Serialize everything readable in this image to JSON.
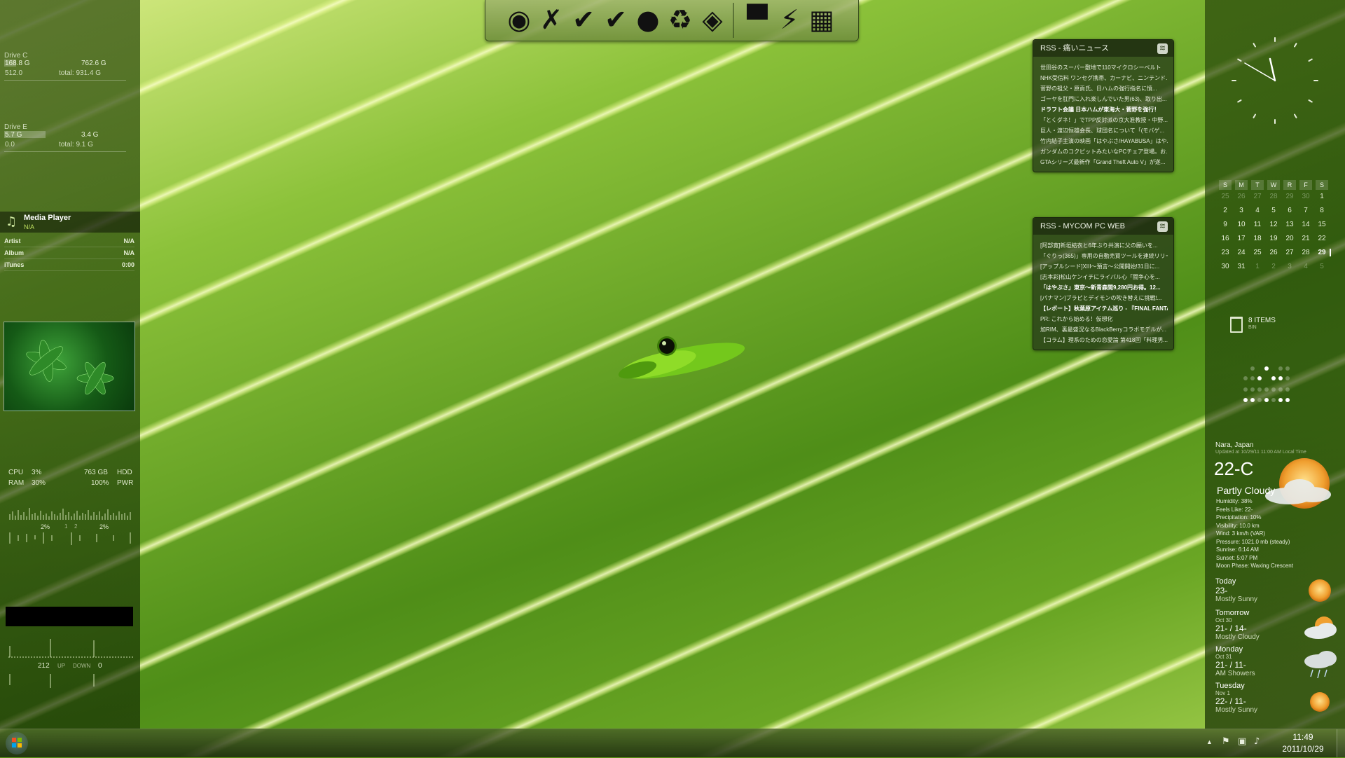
{
  "drives": [
    {
      "label": "Drive C",
      "used": "168.8 G",
      "free": "762.6 G",
      "read": "512.0",
      "total": "total: 931.4 G",
      "used_fraction": 0.18
    },
    {
      "label": "Drive E",
      "used": "5.7 G",
      "free": "3.4 G",
      "read": "0.0",
      "total": "total: 9.1 G",
      "used_fraction": 0.63
    }
  ],
  "media_player": {
    "title": "Media Player",
    "status": "N/A",
    "rows": [
      {
        "label": "Artist",
        "value": "N/A"
      },
      {
        "label": "Album",
        "value": "N/A"
      },
      {
        "label": "iTunes",
        "value": "0:00"
      }
    ]
  },
  "system_meter": {
    "cpu_label": "CPU",
    "cpu_value": "3%",
    "ram_label": "RAM",
    "ram_value": "30%",
    "hdd_value": "763 GB",
    "hdd_label": "HDD",
    "pwr_value": "100%",
    "pwr_label": "PWR",
    "core1": "2%",
    "core_sep1": "1",
    "core_sep2": "2",
    "core2": "2%"
  },
  "network": {
    "up_value": "212",
    "up_label": "UP",
    "down_label": "DOWN",
    "down_value": "0"
  },
  "dock_icons": [
    {
      "name": "firefox-icon",
      "glyph": "◉"
    },
    {
      "name": "cross-icon",
      "glyph": "✗"
    },
    {
      "name": "check-icon",
      "glyph": "✔"
    },
    {
      "name": "check-icon-2",
      "glyph": "✔"
    },
    {
      "name": "apple-icon",
      "glyph": "●"
    },
    {
      "name": "recycle-icon",
      "glyph": "♻"
    },
    {
      "name": "target-icon",
      "glyph": "◈"
    },
    {
      "name": "computer-icon",
      "glyph": "▀"
    },
    {
      "name": "lightning-icon",
      "glyph": "⚡"
    },
    {
      "name": "windows-icon",
      "glyph": "▦"
    }
  ],
  "rss_feeds": [
    {
      "title": "RSS - 痛いニュース",
      "items": [
        {
          "text": "世田谷のスーパー敷地で110マイクロシーベルト",
          "bold": false
        },
        {
          "text": "NHK受信料 ワンセグ携帯、カーナビ、ニンテンド...",
          "bold": false
        },
        {
          "text": "菅野の祖父・原貢氏、日ハムの強行指名に憤...",
          "bold": false
        },
        {
          "text": "ゴーヤを肛門に入れ楽しんでいた男(63)、取り出...",
          "bold": false
        },
        {
          "text": "ドラフト会議 日本ハムが東海大・菅野を強行！",
          "bold": true
        },
        {
          "text": "「とくダネ！」でTPP反対派の京大准教授・中野...",
          "bold": false
        },
        {
          "text": "巨人・渡辺恒雄会長、球団名について「(モバゲ...",
          "bold": false
        },
        {
          "text": "竹内結子主演の映画「はやぶさ/HAYABUSA」はやぶ...",
          "bold": false
        },
        {
          "text": "ガンダムのコクピットみたいなPCチェア登場。お...",
          "bold": false
        },
        {
          "text": "GTAシリーズ最新作「Grand Theft Auto V」が遂...",
          "bold": false
        }
      ]
    },
    {
      "title": "RSS - MYCOM PC WEB",
      "items": [
        {
          "text": "[阿部寛]新垣結衣と6年ぶり共演に父の願いを...",
          "bold": false
        },
        {
          "text": "「ぐりっ(365)」専用の自動売買ツールを連続リリー...",
          "bold": false
        },
        {
          "text": "[アップルシード]XIII～預言～公開開始!31日に...",
          "bold": false
        },
        {
          "text": "[志本彩]松山ケンイチにライバル心「闘争心を...",
          "bold": false
        },
        {
          "text": "「はやぶさ」東京～新青森間9,280円お得。12...",
          "bold": true
        },
        {
          "text": "[パナマン]ブラピとデイモンの吹き替えに挑戦!...",
          "bold": false
        },
        {
          "text": "【レポート】秋葉原アイテム巡り - 『FINAL FANTA...",
          "bold": true
        },
        {
          "text": "PR: これから始める！仮想化",
          "bold": false
        },
        {
          "text": "加RIM、裏最盛況なるBlackBerryコラボモデルが...",
          "bold": false
        },
        {
          "text": "【コラム】理系のための恋愛論 第418回「料理男...",
          "bold": false
        }
      ]
    }
  ],
  "calendar": {
    "headers": [
      "S",
      "M",
      "T",
      "W",
      "R",
      "F",
      "S"
    ],
    "weeks": [
      [
        {
          "d": "25",
          "dim": true
        },
        {
          "d": "26",
          "dim": true
        },
        {
          "d": "27",
          "dim": true
        },
        {
          "d": "28",
          "dim": true
        },
        {
          "d": "29",
          "dim": true
        },
        {
          "d": "30",
          "dim": true
        },
        {
          "d": "1"
        }
      ],
      [
        {
          "d": "2"
        },
        {
          "d": "3"
        },
        {
          "d": "4"
        },
        {
          "d": "5"
        },
        {
          "d": "6"
        },
        {
          "d": "7"
        },
        {
          "d": "8"
        }
      ],
      [
        {
          "d": "9"
        },
        {
          "d": "10"
        },
        {
          "d": "11"
        },
        {
          "d": "12"
        },
        {
          "d": "13"
        },
        {
          "d": "14"
        },
        {
          "d": "15"
        }
      ],
      [
        {
          "d": "16"
        },
        {
          "d": "17"
        },
        {
          "d": "18"
        },
        {
          "d": "19"
        },
        {
          "d": "20"
        },
        {
          "d": "21"
        },
        {
          "d": "22"
        }
      ],
      [
        {
          "d": "23"
        },
        {
          "d": "24"
        },
        {
          "d": "25"
        },
        {
          "d": "26"
        },
        {
          "d": "27"
        },
        {
          "d": "28"
        },
        {
          "d": "29",
          "today": true
        }
      ],
      [
        {
          "d": "30"
        },
        {
          "d": "31"
        },
        {
          "d": "1",
          "dim": true
        },
        {
          "d": "2",
          "dim": true
        },
        {
          "d": "3",
          "dim": true
        },
        {
          "d": "4",
          "dim": true
        },
        {
          "d": "5",
          "dim": true
        }
      ]
    ]
  },
  "recycle_bin": {
    "count": "8 ITEMS",
    "label": "BIN"
  },
  "weather": {
    "location": "Nara, Japan",
    "updated": "Updated at 10/29/11 11:00 AM Local Time",
    "temp": "22-C",
    "condition": "Partly Cloudy",
    "details": [
      "Humidity: 38%",
      "Feels Like: 22-",
      "Precipitation: 10%",
      "Visibility: 10.0 km",
      "Wind: 3 km/h (VAR)",
      "Pressure: 1021.0 mb (steady)",
      "Sunrise: 6:14 AM",
      "Sunset: 5:07 PM",
      "Moon Phase: Waxing Crescent"
    ],
    "forecast": [
      {
        "day": "Today",
        "date": "",
        "temps": "23-",
        "cond": "Mostly Sunny",
        "icon": "sun-icon"
      },
      {
        "day": "Tomorrow",
        "date": "Oct 30",
        "temps": "21- / 14-",
        "cond": "Mostly Cloudy",
        "icon": "cloud-icon"
      },
      {
        "day": "Monday",
        "date": "Oct 31",
        "temps": "21- / 11-",
        "cond": "AM Showers",
        "icon": "rain-icon"
      },
      {
        "day": "Tuesday",
        "date": "Nov 1",
        "temps": "22- / 11-",
        "cond": "Mostly Sunny",
        "icon": "sun-icon"
      }
    ]
  },
  "taskbar": {
    "time": "11:49",
    "date": "2011/10/29"
  },
  "colors": {
    "accent": "#8cc23a",
    "panel": "#2a4a0a",
    "sun": "#f0a030"
  }
}
